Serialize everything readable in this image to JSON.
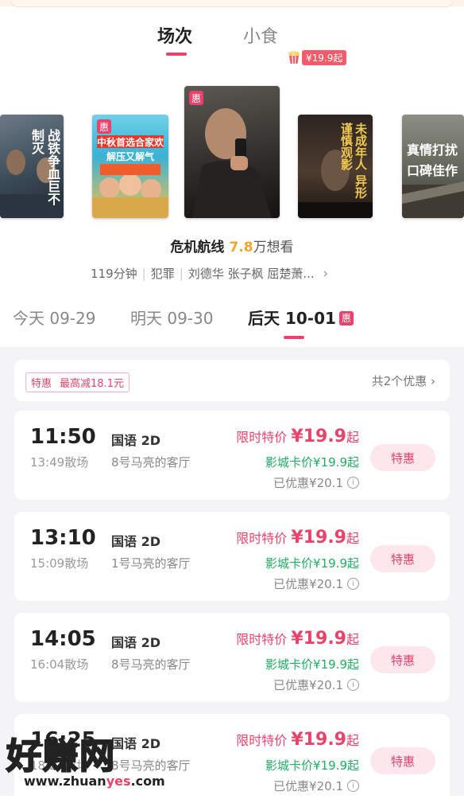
{
  "tabs": {
    "screenings": "场次",
    "snacks": "小食",
    "snack_price_badge": "¥19.9起"
  },
  "posters": [
    {
      "title": "战铁争血巨不制灭",
      "badge": ""
    },
    {
      "title": "中秋首选合家欢 解压又解气",
      "badge": "惠"
    },
    {
      "title": "",
      "badge": "惠"
    },
    {
      "title": "未成年人 异形 谨慎观影",
      "badge": ""
    },
    {
      "title": "真情打扰 口碑佳作",
      "badge": ""
    }
  ],
  "movie": {
    "title": "危机航线",
    "want_count": "7.8",
    "want_label": "万想看",
    "duration": "119分钟",
    "genre": "犯罪",
    "cast": "刘德华  张子枫  屈楚萧...",
    "chevron": "›"
  },
  "dates": [
    {
      "label": "今天 09-29",
      "active": false
    },
    {
      "label": "明天 09-30",
      "active": false
    },
    {
      "label": "后天 10-01",
      "active": true,
      "badge": "惠"
    }
  ],
  "promo": {
    "tag": "特惠",
    "text": "最高减18.1元",
    "right": "共2个优惠 ›"
  },
  "showtimes": [
    {
      "start": "11:50",
      "end": "13:49散场",
      "lang": "国语 2D",
      "hall": "8号马亮的客厅",
      "limited_label": "限时特价",
      "price": "¥19.9",
      "suffix": "起",
      "card_price": "影城卡价¥19.9起",
      "saved": "已优惠¥20.1",
      "button": "特惠"
    },
    {
      "start": "13:10",
      "end": "15:09散场",
      "lang": "国语 2D",
      "hall": "1号马亮的客厅",
      "limited_label": "限时特价",
      "price": "¥19.9",
      "suffix": "起",
      "card_price": "影城卡价¥19.9起",
      "saved": "已优惠¥20.1",
      "button": "特惠"
    },
    {
      "start": "14:05",
      "end": "16:04散场",
      "lang": "国语 2D",
      "hall": "8号马亮的客厅",
      "limited_label": "限时特价",
      "price": "¥19.9",
      "suffix": "起",
      "card_price": "影城卡价¥19.9起",
      "saved": "已优惠¥20.1",
      "button": "特惠"
    },
    {
      "start": "16:25",
      "end": "18:24散场",
      "lang": "国语 2D",
      "hall": "8号马亮的客厅",
      "limited_label": "限时特价",
      "price": "¥19.9",
      "suffix": "起",
      "card_price": "影城卡价¥19.9起",
      "saved": "已优惠¥20.1",
      "button": "特惠"
    }
  ],
  "watermark": {
    "cn": "好赚网",
    "url_a": "www.zhuan",
    "url_b": "yes",
    "url_c": ".com"
  }
}
